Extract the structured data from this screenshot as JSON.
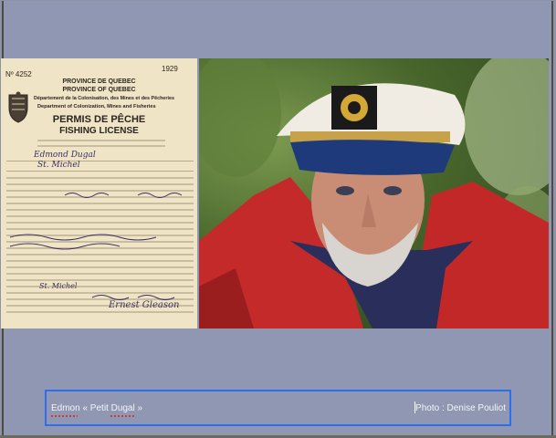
{
  "license": {
    "number": "Nº 4252",
    "year": "1929",
    "province_fr": "PROVINCE DE QUEBEC",
    "province_en": "PROVINCE OF QUEBEC",
    "dept_fr": "Département de la Colonisation, des Mines et des Pêcheries",
    "dept_en": "Department of Colonization, Mines and Fisheries",
    "title_fr": "PERMIS DE PÊCHE",
    "title_en": "FISHING LICENSE",
    "name_handwritten": "Edmond Dugal",
    "place_handwritten": "St. Michel",
    "place_footer": "St. Michel",
    "signature": "Ernest Gleason"
  },
  "photo": {
    "subject": "portrait"
  },
  "caption": {
    "left": "Edmon « Petit Dugal »",
    "right": "Photo : Denise Pouliot"
  }
}
